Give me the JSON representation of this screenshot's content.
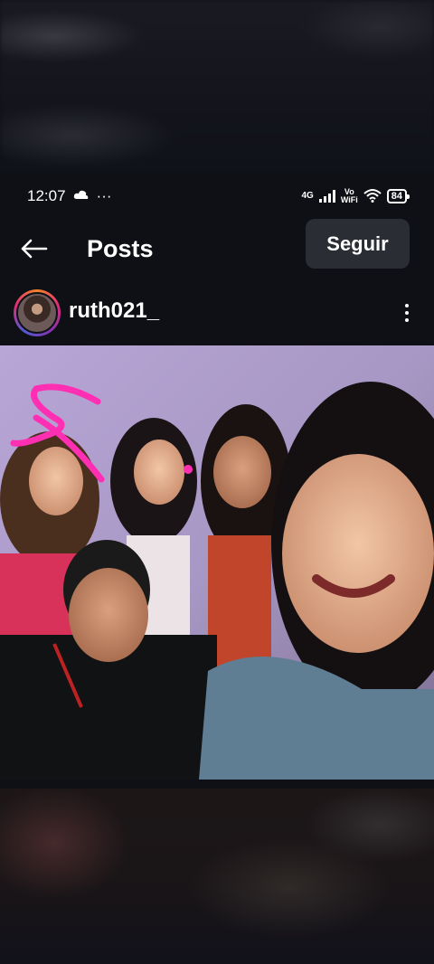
{
  "status_bar": {
    "time": "12:07",
    "dots": "···",
    "network": "4G",
    "vowifi_top": "Vo",
    "vowifi_bottom": "WiFi",
    "battery": "84"
  },
  "header": {
    "title": "Posts",
    "follow_label": "Seguir"
  },
  "post": {
    "username": "ruth021_"
  },
  "icons": {
    "back": "arrow-left-icon",
    "more": "vertical-dots-icon",
    "wifi": "wifi-icon",
    "signal": "signal-bars-icon",
    "cloud": "cloud-icon"
  }
}
